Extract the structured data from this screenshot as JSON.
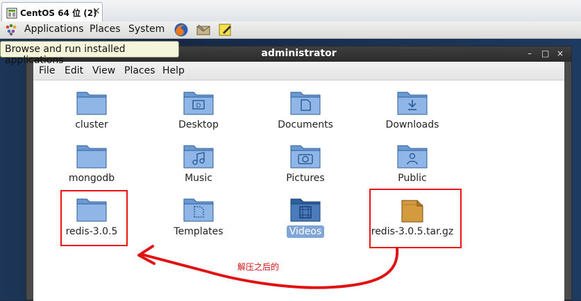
{
  "vm_tab": {
    "title": "CentOS 64 位 (2)",
    "close": "×"
  },
  "panel": {
    "applications": "Applications",
    "places": "Places",
    "system": "System"
  },
  "tooltip": "Browse and run installed applications",
  "window": {
    "title": "administrator",
    "buttons": {
      "minimize": "–",
      "maximize": "□",
      "close": "×"
    }
  },
  "menubar": [
    "File",
    "Edit",
    "View",
    "Places",
    "Help"
  ],
  "items": [
    {
      "label": "cluster",
      "icon": "folder-icon"
    },
    {
      "label": "Desktop",
      "icon": "folder-desktop-icon"
    },
    {
      "label": "Documents",
      "icon": "folder-documents-icon"
    },
    {
      "label": "Downloads",
      "icon": "folder-downloads-icon"
    },
    {
      "label": "mongodb",
      "icon": "folder-icon"
    },
    {
      "label": "Music",
      "icon": "folder-music-icon"
    },
    {
      "label": "Pictures",
      "icon": "folder-pictures-icon"
    },
    {
      "label": "Public",
      "icon": "folder-public-icon"
    },
    {
      "label": "redis-3.0.5",
      "icon": "folder-icon"
    },
    {
      "label": "Templates",
      "icon": "folder-templates-icon"
    },
    {
      "label": "Videos",
      "icon": "folder-videos-icon",
      "selected": true
    },
    {
      "label": "redis-3.0.5.tar.gz",
      "icon": "archive-icon"
    }
  ],
  "annotation": {
    "text": "解压之后的",
    "color": "#e11111"
  }
}
